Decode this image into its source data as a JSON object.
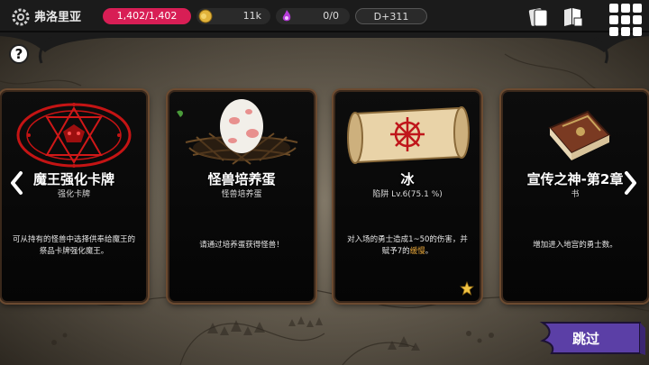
{
  "header": {
    "place_name": "弗洛里亚",
    "hp": "1,402/1,402",
    "gold": "11k",
    "souls": "0/0",
    "day": "D+311"
  },
  "help": {
    "label": "?"
  },
  "cards": [
    {
      "title": "魔王强化卡牌",
      "subtitle": "强化卡牌",
      "description": "可从持有的怪兽中选择供奉给魔王的祭品卡牌强化魔王。",
      "art_icon": "magic-circle-icon"
    },
    {
      "title": "怪兽培养蛋",
      "subtitle": "怪兽培养蛋",
      "description": "请通过培养蛋获得怪兽！",
      "art_icon": "egg-in-nest-icon"
    },
    {
      "title": "冰",
      "subtitle": "陷阱 Lv.6(75.1 %)",
      "description_main": "对入场的勇士造成1~50的伤害，并赋予7的",
      "description_highlight": "缓慢",
      "description_end": "。",
      "art_icon": "scroll-icon"
    },
    {
      "title": "宣传之神-第2章",
      "subtitle": "书",
      "description": "增加进入地宫的勇士数。",
      "art_icon": "book-icon"
    }
  ],
  "skip": {
    "label": "跳过"
  },
  "colors": {
    "hp_pill": "#d81e55",
    "skip_button": "#5b3fa6",
    "highlight": "#e8a73a"
  }
}
